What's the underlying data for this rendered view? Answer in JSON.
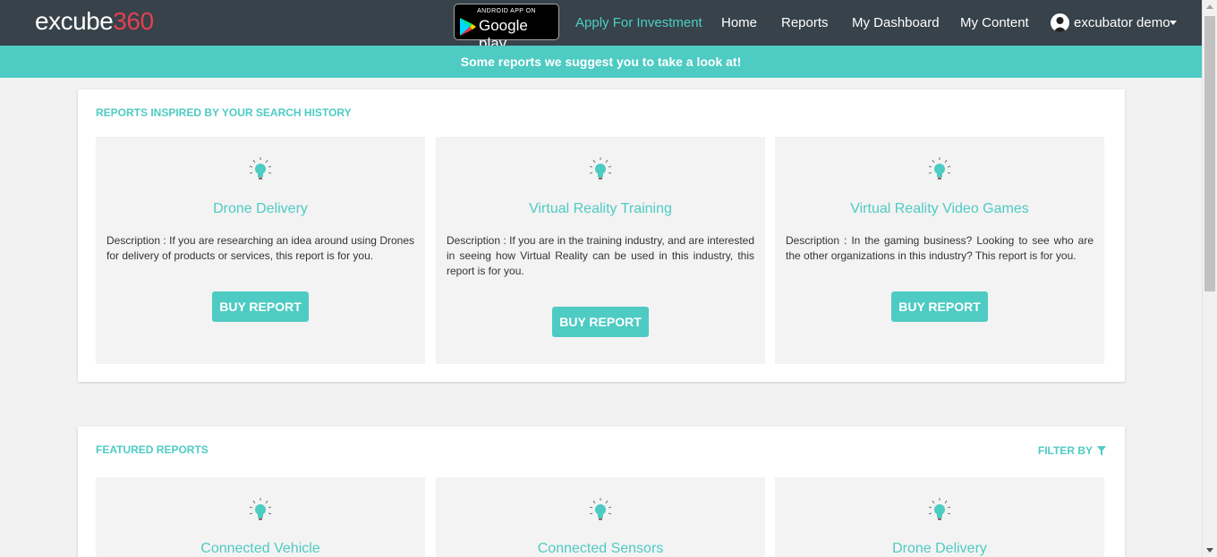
{
  "brand": {
    "logo_text": "excube",
    "logo_number": "360"
  },
  "google_play": {
    "small_text": "ANDROID APP ON",
    "big_text": "Google play"
  },
  "nav": {
    "apply": "Apply For Investment",
    "home": "Home",
    "reports": "Reports",
    "dashboard": "My Dashboard",
    "content": "My Content",
    "user": "excubator demo"
  },
  "banner": {
    "text": "Some reports we suggest you to take a look at!"
  },
  "history": {
    "title": "REPORTS INSPIRED BY YOUR SEARCH HISTORY",
    "cards": [
      {
        "title": "Drone Delivery",
        "description": "Description : If you are researching an idea around using Drones for delivery of products or services, this report is for you.",
        "button": "BUY REPORT"
      },
      {
        "title": "Virtual Reality Training",
        "description": "Description : If you are in the training industry, and are interested in seeing how Virtual Reality can be used in this industry, this report is for you.",
        "button": "BUY REPORT"
      },
      {
        "title": "Virtual Reality Video Games",
        "description": "Description : In the gaming business? Looking to see who are the other organizations in this industry? This report is for you.",
        "button": "BUY REPORT"
      }
    ]
  },
  "featured": {
    "title": "FEATURED REPORTS",
    "filter": "FILTER BY",
    "cards": [
      {
        "title": "Connected Vehicle"
      },
      {
        "title": "Connected Sensors"
      },
      {
        "title": "Drone Delivery"
      }
    ]
  },
  "colors": {
    "accent": "#4ecbc3",
    "nav_bg": "#37424a",
    "logo_number": "#e4404f"
  },
  "icons": {
    "card_icon": "lightbulb-icon",
    "filter_icon": "funnel-icon",
    "user_icon": "user-avatar-icon"
  }
}
